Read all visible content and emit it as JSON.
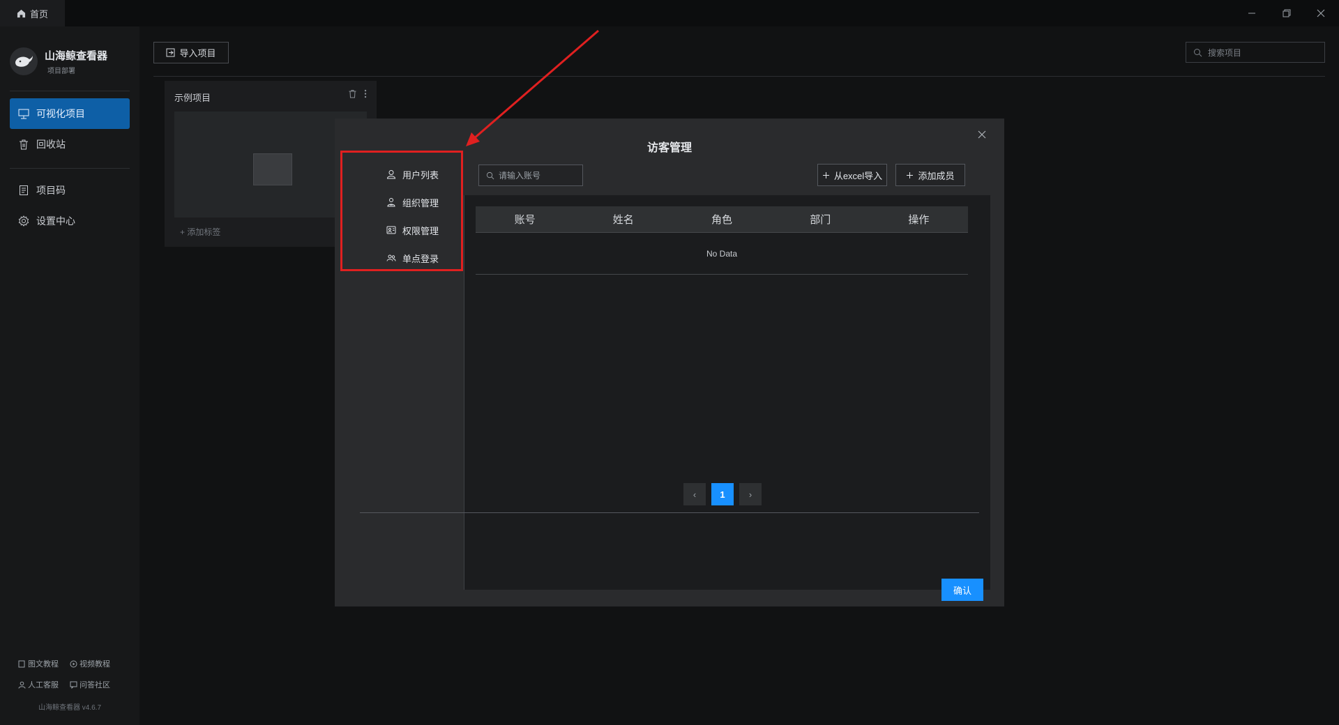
{
  "titlebar": {
    "home_tab": "首页",
    "icons": [
      "home-icon",
      "minimize-icon",
      "restore-icon",
      "close-icon"
    ]
  },
  "sidebar": {
    "brand_name": "山海鲸查看器",
    "brand_sub": "项目部署",
    "items": [
      {
        "label": "可视化项目",
        "icon": "presentation-icon",
        "active": true
      },
      {
        "label": "回收站",
        "icon": "trash-icon",
        "active": false
      },
      {
        "label": "项目码",
        "icon": "document-icon",
        "active": false
      },
      {
        "label": "设置中心",
        "icon": "gear-icon",
        "active": false
      }
    ],
    "footer": {
      "tutorial_text": "图文教程",
      "tutorial_video": "视频教程",
      "support": "人工客服",
      "community": "问答社区"
    },
    "version": "山海鲸查看器 v4.6.7"
  },
  "main": {
    "import_button": "导入项目",
    "search_placeholder": "搜索项目",
    "project_card": {
      "title": "示例项目",
      "tag": "+ 添加标签"
    }
  },
  "modal": {
    "title": "访客管理",
    "menu": [
      {
        "label": "用户列表",
        "icon": "user-icon"
      },
      {
        "label": "组织管理",
        "icon": "org-icon"
      },
      {
        "label": "权限管理",
        "icon": "permission-icon"
      },
      {
        "label": "单点登录",
        "icon": "group-icon"
      }
    ],
    "search_placeholder": "请输入账号",
    "import_excel_button": "从excel导入",
    "add_member_button": "添加成员",
    "table": {
      "columns": [
        "账号",
        "姓名",
        "角色",
        "部门",
        "操作"
      ],
      "empty_text": "No Data"
    },
    "pagination": {
      "current_page": "1",
      "prev": "‹",
      "next": "›"
    },
    "confirm_button": "确认"
  },
  "colors": {
    "accent": "#1890ff",
    "sidebar_active": "#0e5fa6",
    "annotation": "#e02020"
  }
}
